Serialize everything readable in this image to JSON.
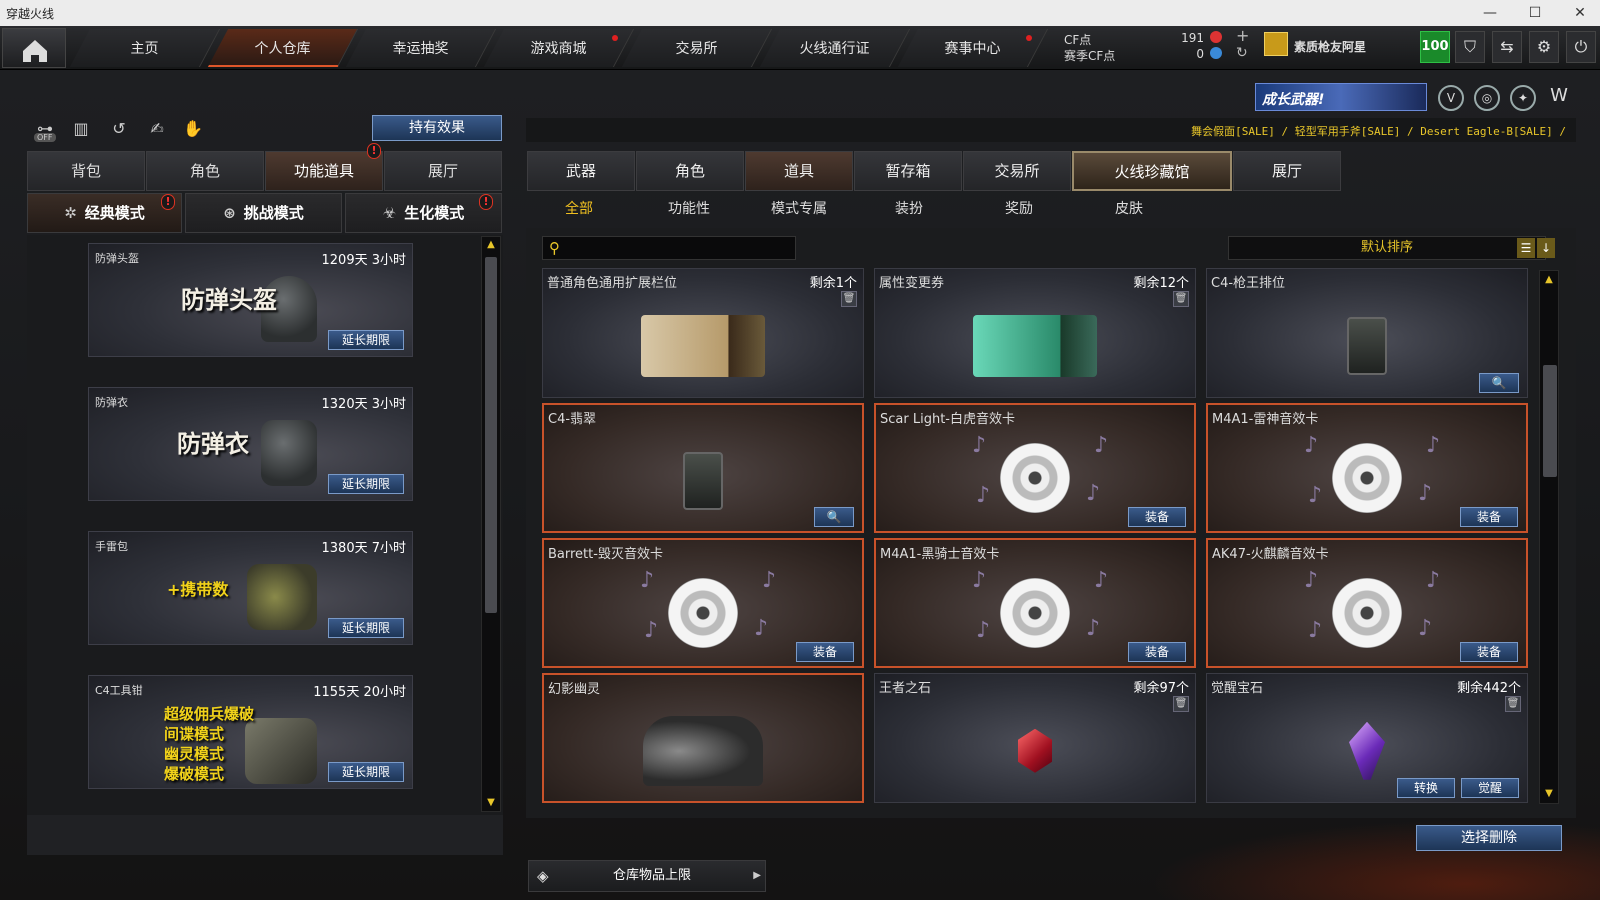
{
  "window": {
    "title": "穿越火线",
    "controls": [
      "—",
      "☐",
      "✕"
    ]
  },
  "nav": {
    "items": [
      {
        "label": "主页",
        "dot": false
      },
      {
        "label": "个人仓库",
        "dot": false
      },
      {
        "label": "幸运抽奖",
        "dot": false
      },
      {
        "label": "游戏商城",
        "dot": true
      },
      {
        "label": "交易所",
        "dot": false
      },
      {
        "label": "火线通行证",
        "dot": false
      },
      {
        "label": "赛事中心",
        "dot": true
      }
    ],
    "active_index": 1
  },
  "currency": {
    "cf_label": "CF点",
    "cf_value": "191",
    "season_label": "赛季CF点",
    "season_value": "0"
  },
  "user": {
    "name": "素质枪友阿星",
    "level": "100"
  },
  "header_icons": [
    "shield-icon",
    "transfer-icon",
    "gear-icon",
    "power-icon"
  ],
  "promo": {
    "banner_text": "成长武器!",
    "ticker": "舞会假面[SALE] / 轻型军用手斧[SALE] / Desert Eagle-B[SALE] /"
  },
  "left": {
    "effect_button": "持有效果",
    "tool_icons": [
      "off-toggle-icon",
      "gift-icon",
      "refresh-icon",
      "hand-icon",
      "glove-icon"
    ],
    "tool_off_label": "OFF",
    "tabs": [
      "背包",
      "角色",
      "功能道具",
      "展厅"
    ],
    "active_tab": 2,
    "modes": [
      {
        "label": "经典模式",
        "alert": true
      },
      {
        "label": "挑战模式",
        "alert": false
      },
      {
        "label": "生化模式",
        "alert": true
      }
    ],
    "alert_mark": "!",
    "extend_label": "延长期限",
    "items": [
      {
        "name": "防弹头盔",
        "time": "1209天 3小时",
        "art": "防弹头盔"
      },
      {
        "name": "防弹衣",
        "time": "1320天 3小时",
        "art": "防弹衣"
      },
      {
        "name": "手雷包",
        "time": "1380天 7小时",
        "art": "+携带数"
      },
      {
        "name": "C4工具钳",
        "time": "1155天 20小时",
        "art_lines": [
          "超级佣兵爆破",
          "间谍模式",
          "幽灵模式",
          "爆破模式"
        ]
      }
    ]
  },
  "right": {
    "tabs": [
      "武器",
      "角色",
      "道具",
      "暂存箱",
      "交易所",
      "火线珍藏馆",
      "展厅"
    ],
    "active_tab": 2,
    "special_tab": 5,
    "subtabs": [
      "全部",
      "功能性",
      "模式专属",
      "装扮",
      "奖励",
      "皮肤"
    ],
    "active_subtab": 0,
    "search_placeholder": "",
    "sort_label": "默认排序",
    "equip_label": "装备",
    "convert_label": "转换",
    "awaken_label": "觉醒",
    "items": [
      {
        "name": "普通角色通用扩展栏位",
        "count": "剩余1个",
        "style": "ticket-gold"
      },
      {
        "name": "属性变更券",
        "count": "剩余12个",
        "style": "ticket-green"
      },
      {
        "name": "C4-枪王排位",
        "count": "",
        "style": "c4"
      },
      {
        "name": "C4-翡翠",
        "count": "",
        "style": "c4"
      },
      {
        "name": "Scar Light-白虎音效卡",
        "count": "",
        "style": "disc"
      },
      {
        "name": "M4A1-雷神音效卡",
        "count": "",
        "style": "disc"
      },
      {
        "name": "Barrett-毁灭音效卡",
        "count": "",
        "style": "disc"
      },
      {
        "name": "M4A1-黑骑士音效卡",
        "count": "",
        "style": "disc"
      },
      {
        "name": "AK47-火麒麟音效卡",
        "count": "",
        "style": "disc"
      },
      {
        "name": "幻影幽灵",
        "count": "",
        "style": "ghost"
      },
      {
        "name": "王者之石",
        "count": "剩余97个",
        "style": "ruby"
      },
      {
        "name": "觉醒宝石",
        "count": "剩余442个",
        "style": "crystal"
      }
    ],
    "select_delete": "选择删除",
    "capacity_label": "仓库物品上限"
  }
}
